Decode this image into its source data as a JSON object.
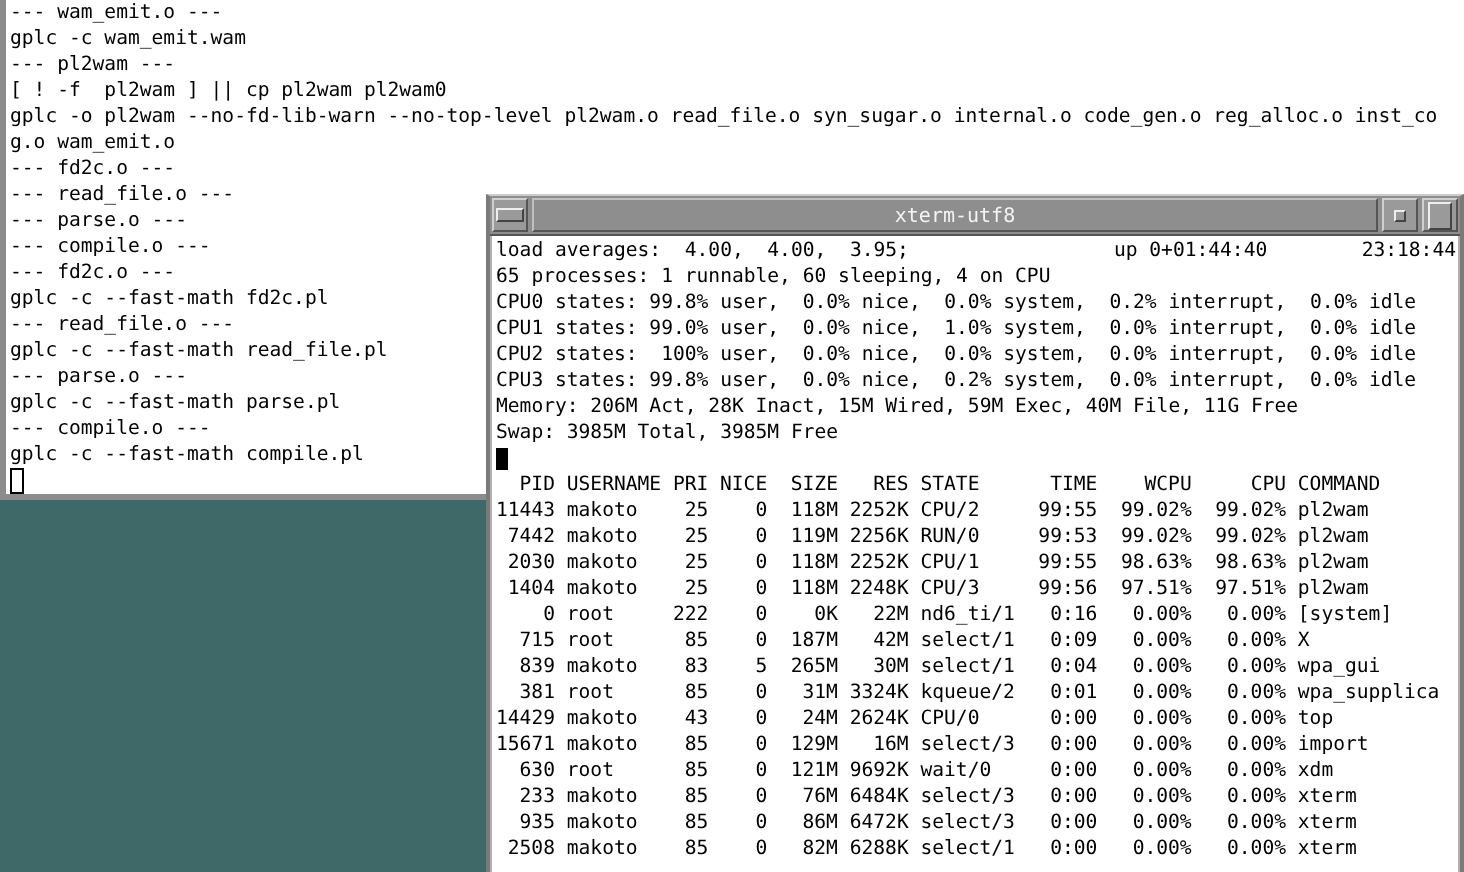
{
  "back_terminal": {
    "lines": [
      "--- wam_emit.o ---",
      "gplc -c wam_emit.wam",
      "--- pl2wam ---",
      "[ ! -f  pl2wam ] || cp pl2wam pl2wam0",
      "gplc -o pl2wam --no-fd-lib-warn --no-top-level pl2wam.o read_file.o syn_sugar.o internal.o code_gen.o reg_alloc.o inst_co",
      "g.o wam_emit.o",
      "--- fd2c.o ---",
      "--- read_file.o ---",
      "--- parse.o ---",
      "--- compile.o ---",
      "--- fd2c.o ---",
      "gplc -c --fast-math fd2c.pl",
      "--- read_file.o ---",
      "gplc -c --fast-math read_file.pl",
      "--- parse.o ---",
      "gplc -c --fast-math parse.pl",
      "--- compile.o ---",
      "gplc -c --fast-math compile.pl"
    ]
  },
  "top_window": {
    "title": "xterm-utf8",
    "load_averages": "load averages:  4.00,  4.00,  3.95;",
    "uptime": "up 0+01:44:40",
    "clock": "23:18:44",
    "summary_lines": [
      "65 processes: 1 runnable, 60 sleeping, 4 on CPU",
      "CPU0 states: 99.8% user,  0.0% nice,  0.0% system,  0.2% interrupt,  0.0% idle",
      "CPU1 states: 99.0% user,  0.0% nice,  1.0% system,  0.0% interrupt,  0.0% idle",
      "CPU2 states:  100% user,  0.0% nice,  0.0% system,  0.0% interrupt,  0.0% idle",
      "CPU3 states: 99.8% user,  0.0% nice,  0.2% system,  0.0% interrupt,  0.0% idle",
      "Memory: 206M Act, 28K Inact, 15M Wired, 59M Exec, 40M File, 11G Free",
      "Swap: 3985M Total, 3985M Free"
    ],
    "table": {
      "columns": [
        "PID",
        "USERNAME",
        "PRI",
        "NICE",
        "SIZE",
        "RES",
        "STATE",
        "TIME",
        "WCPU",
        "CPU",
        "COMMAND"
      ],
      "rows": [
        [
          "11443",
          "makoto",
          "25",
          "0",
          "118M",
          "2252K",
          "CPU/2",
          "99:55",
          "99.02%",
          "99.02%",
          "pl2wam"
        ],
        [
          "7442",
          "makoto",
          "25",
          "0",
          "119M",
          "2256K",
          "RUN/0",
          "99:53",
          "99.02%",
          "99.02%",
          "pl2wam"
        ],
        [
          "2030",
          "makoto",
          "25",
          "0",
          "118M",
          "2252K",
          "CPU/1",
          "99:55",
          "98.63%",
          "98.63%",
          "pl2wam"
        ],
        [
          "1404",
          "makoto",
          "25",
          "0",
          "118M",
          "2248K",
          "CPU/3",
          "99:56",
          "97.51%",
          "97.51%",
          "pl2wam"
        ],
        [
          "0",
          "root",
          "222",
          "0",
          "0K",
          "22M",
          "nd6_ti/1",
          "0:16",
          "0.00%",
          "0.00%",
          "[system]"
        ],
        [
          "715",
          "root",
          "85",
          "0",
          "187M",
          "42M",
          "select/1",
          "0:09",
          "0.00%",
          "0.00%",
          "X"
        ],
        [
          "839",
          "makoto",
          "83",
          "5",
          "265M",
          "30M",
          "select/1",
          "0:04",
          "0.00%",
          "0.00%",
          "wpa_gui"
        ],
        [
          "381",
          "root",
          "85",
          "0",
          "31M",
          "3324K",
          "kqueue/2",
          "0:01",
          "0.00%",
          "0.00%",
          "wpa_supplica"
        ],
        [
          "14429",
          "makoto",
          "43",
          "0",
          "24M",
          "2624K",
          "CPU/0",
          "0:00",
          "0.00%",
          "0.00%",
          "top"
        ],
        [
          "15671",
          "makoto",
          "85",
          "0",
          "129M",
          "16M",
          "select/3",
          "0:00",
          "0.00%",
          "0.00%",
          "import"
        ],
        [
          "630",
          "root",
          "85",
          "0",
          "121M",
          "9692K",
          "wait/0",
          "0:00",
          "0.00%",
          "0.00%",
          "xdm"
        ],
        [
          "233",
          "makoto",
          "85",
          "0",
          "76M",
          "6484K",
          "select/3",
          "0:00",
          "0.00%",
          "0.00%",
          "xterm"
        ],
        [
          "935",
          "makoto",
          "85",
          "0",
          "86M",
          "6472K",
          "select/3",
          "0:00",
          "0.00%",
          "0.00%",
          "xterm"
        ],
        [
          "2508",
          "makoto",
          "85",
          "0",
          "82M",
          "6288K",
          "select/1",
          "0:00",
          "0.00%",
          "0.00%",
          "xterm"
        ]
      ]
    }
  }
}
